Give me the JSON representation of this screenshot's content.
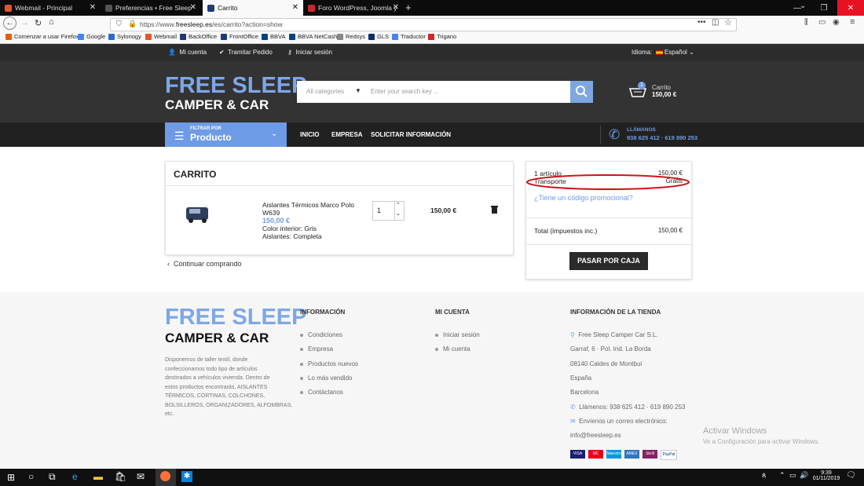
{
  "browser": {
    "tabs": [
      {
        "title": "Webmail - Principal",
        "fav_color": "#e8542a"
      },
      {
        "title": "Preferencias • Free Sleep Camper",
        "fav_color": "#555555"
      },
      {
        "title": "Carrito",
        "fav_color": "#1e3c74"
      },
      {
        "title": "Foro WordPress, Joomla y Presta",
        "fav_color": "#c8282c"
      }
    ],
    "url_prefix": "https://www.",
    "url_domain": "freesleep.es",
    "url_path": "/es/carrito?action=show",
    "bookmarks": [
      {
        "label": "Comenzar a usar Firefox",
        "color": "#e66000"
      },
      {
        "label": "Google",
        "color": "#4285f4"
      },
      {
        "label": "Sylonogy",
        "color": "#2a6bd1"
      },
      {
        "label": "Webmail",
        "color": "#e8542a"
      },
      {
        "label": "BackOffice",
        "color": "#1e3c74"
      },
      {
        "label": "FrontOffice",
        "color": "#1e3c74"
      },
      {
        "label": "BBVA",
        "color": "#004481"
      },
      {
        "label": "BBVA NetCash",
        "color": "#004481"
      },
      {
        "label": "Redsys",
        "color": "#888888"
      },
      {
        "label": "GLS",
        "color": "#0a2d6e"
      },
      {
        "label": "Traductor",
        "color": "#4285f4"
      },
      {
        "label": "Trigano",
        "color": "#d8232a"
      }
    ]
  },
  "site": {
    "top_links": [
      "Mi cuenta",
      "Tramitar Pedido",
      "Iniciar sesión"
    ],
    "language_label": "Idioma:",
    "language_value": "Español",
    "logo_line1": "FREE SLEEP",
    "logo_line2": "CAMPER & CAR",
    "category_select": "All categories",
    "search_placeholder": "Enter your search key ...",
    "cart_label": "Carrito",
    "cart_total": "150,00 €",
    "cart_count": "1",
    "filter_small": "FILTRAR POR",
    "filter_big": "Producto",
    "nav": [
      "INICIO",
      "EMPRESA",
      "SOLICITAR INFORMACIÓN"
    ],
    "call_label": "LLÁMANOS",
    "call_numbers": "938 625 412 · 619 890 253"
  },
  "cart": {
    "title": "CARRITO",
    "item": {
      "name_line1": "Aislantes Térmicos Marco Polo",
      "name_line2": "W639",
      "price": "150,00 €",
      "color": "Color interior: Gris",
      "aislantes": "Aislantes: Completa",
      "quantity": "1",
      "total": "150,00 €"
    },
    "continue": "Continuar comprando"
  },
  "summary": {
    "items_label": "1 artículo",
    "items_value": "150,00 €",
    "shipping_label": "Transporte",
    "shipping_value": "Gratis",
    "promo": "¿Tiene un código promocional?",
    "total_label": "Total (impuestos inc.)",
    "total_value": "150,00 €",
    "checkout": "PASAR POR CAJA"
  },
  "footer": {
    "logo_line1": "FREE SLEEP",
    "logo_line2": "CAMPER & CAR",
    "about": [
      "Disponemos de taller textil, donde",
      "confeccionamos todo tipo de artículos",
      "destinados a vehículos vivienda. Dentro de",
      "estos productos encontrarás, AISLANTES",
      "TÉRMICOS, CORTINAS, COLCHONES,",
      "BOLSILLEROS, ORGANIZADORES, ALFOMBRAS,",
      "etc."
    ],
    "info_title": "INFORMACIÓN",
    "info_links": [
      "Condiciones",
      "Empresa",
      "Productos nuevos",
      "Lo más vendido",
      "Contáctanos"
    ],
    "account_title": "MI CUENTA",
    "account_links": [
      "Iniciar sesión",
      "Mi cuenta"
    ],
    "store_title": "INFORMACIÓN DE LA TIENDA",
    "store_name": "Free Sleep Camper Car S.L.",
    "store_lines": [
      "Garraf, 6 · Pol. Ind. La Borda",
      "08140 Caldes de Montbui",
      "España",
      "Barcelona"
    ],
    "store_phone": "Llámenos: 938 625 412 · 619 890 253",
    "store_email_label": "Envíenos un correo electrónico:",
    "store_email": "info@freesleep.es",
    "payments": [
      "VISA",
      "MC",
      "Maestro",
      "AMEX",
      "Skrill",
      "PayPal"
    ]
  },
  "windows": {
    "activate_title": "Activar Windows",
    "activate_sub": "Ve a Configuración para activar Windows.",
    "time": "9:39",
    "date": "01/11/2019"
  }
}
